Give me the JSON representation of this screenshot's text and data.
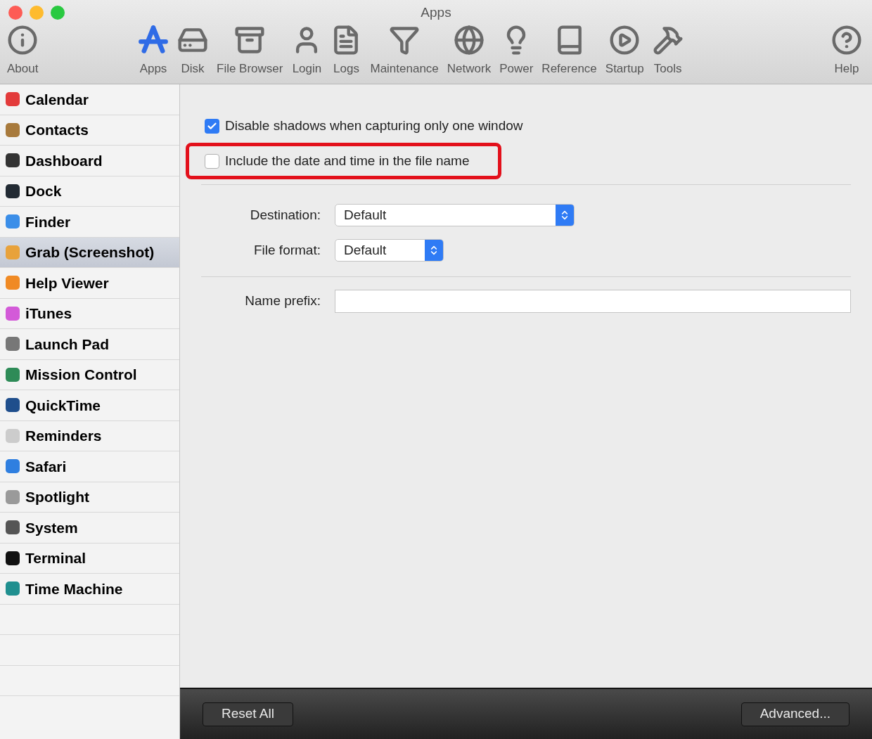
{
  "window": {
    "title": "Apps"
  },
  "toolbar": [
    {
      "label": "About",
      "selected": false
    },
    {
      "label": "Apps",
      "selected": true
    },
    {
      "label": "Disk",
      "selected": false
    },
    {
      "label": "File Browser",
      "selected": false
    },
    {
      "label": "Login",
      "selected": false
    },
    {
      "label": "Logs",
      "selected": false
    },
    {
      "label": "Maintenance",
      "selected": false
    },
    {
      "label": "Network",
      "selected": false
    },
    {
      "label": "Power",
      "selected": false
    },
    {
      "label": "Reference",
      "selected": false
    },
    {
      "label": "Startup",
      "selected": false
    },
    {
      "label": "Tools",
      "selected": false
    },
    {
      "label": "Help",
      "selected": false
    }
  ],
  "sidebar": {
    "items": [
      {
        "label": "Calendar",
        "selected": false
      },
      {
        "label": "Contacts",
        "selected": false
      },
      {
        "label": "Dashboard",
        "selected": false
      },
      {
        "label": "Dock",
        "selected": false
      },
      {
        "label": "Finder",
        "selected": false
      },
      {
        "label": "Grab (Screenshot)",
        "selected": true
      },
      {
        "label": "Help Viewer",
        "selected": false
      },
      {
        "label": "iTunes",
        "selected": false
      },
      {
        "label": "Launch Pad",
        "selected": false
      },
      {
        "label": "Mission Control",
        "selected": false
      },
      {
        "label": "QuickTime",
        "selected": false
      },
      {
        "label": "Reminders",
        "selected": false
      },
      {
        "label": "Safari",
        "selected": false
      },
      {
        "label": "Spotlight",
        "selected": false
      },
      {
        "label": "System",
        "selected": false
      },
      {
        "label": "Terminal",
        "selected": false
      },
      {
        "label": "Time Machine",
        "selected": false
      }
    ]
  },
  "options": [
    {
      "label": "Disable shadows when capturing only one window",
      "checked": true,
      "highlighted": false
    },
    {
      "label": "Include the date and time in the file name",
      "checked": false,
      "highlighted": true
    }
  ],
  "popups": [
    {
      "label": "Destination:",
      "value": "Default"
    },
    {
      "label": "File format:",
      "value": "Default"
    }
  ],
  "name_prefix": {
    "label": "Name prefix:"
  },
  "buttons": {
    "reset": "Reset All",
    "advanced": "Advanced..."
  }
}
